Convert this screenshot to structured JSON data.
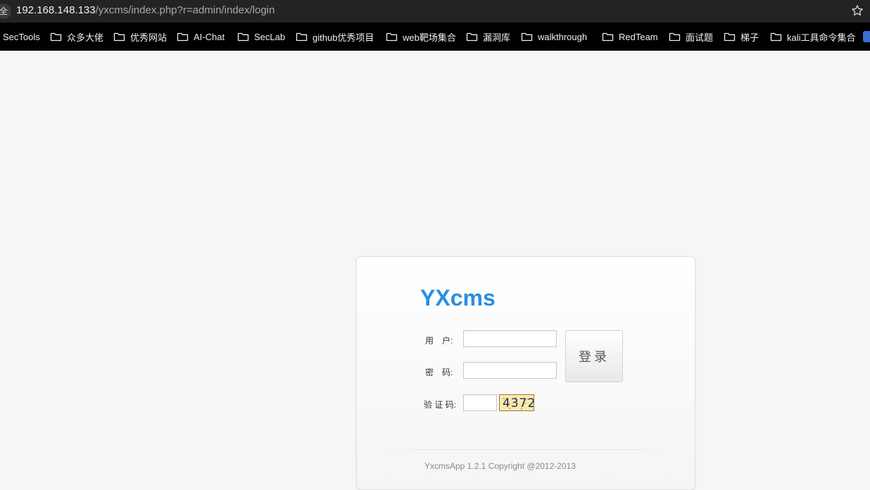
{
  "browser": {
    "site_info_glyph": "全",
    "url_host": "192.168.148.133",
    "url_path": "/yxcms/index.php?r=admin/index/login",
    "bookmark_icon": "star-icon"
  },
  "bookmarks": [
    {
      "label": "SecTools",
      "folder": false
    },
    {
      "label": "众多大佬",
      "folder": true
    },
    {
      "label": "优秀网站",
      "folder": true
    },
    {
      "label": "AI-Chat",
      "folder": true
    },
    {
      "label": "SecLab",
      "folder": true
    },
    {
      "label": "github优秀项目",
      "folder": true
    },
    {
      "label": "web靶场集合",
      "folder": true
    },
    {
      "label": "漏洞库",
      "folder": true
    },
    {
      "label": "walkthrough",
      "folder": true
    },
    {
      "label": "RedTeam",
      "folder": true
    },
    {
      "label": "面试题",
      "folder": true
    },
    {
      "label": "梯子",
      "folder": true
    },
    {
      "label": "kali工具命令集合",
      "folder": true
    }
  ],
  "login": {
    "logo": "YXcms",
    "username_label": "用　户:",
    "password_label": "密　码:",
    "captcha_label": "验 证 码:",
    "username_value": "",
    "password_value": "",
    "captcha_value": "",
    "captcha_image_text": "4372",
    "submit_label": "登录",
    "footer": "YxcmsApp 1.2.1 Copyright @2012-2013"
  },
  "colors": {
    "logo": "#2a8ee0",
    "page_background": "#f6f6f6",
    "captcha_background": "#fbe9a6"
  }
}
